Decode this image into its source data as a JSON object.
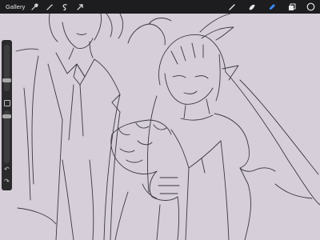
{
  "topbar": {
    "gallery_label": "Gallery",
    "left_tools": [
      "wrench-icon",
      "magic-wand-icon",
      "selection-s-icon",
      "transform-arrow-icon"
    ],
    "right_tools": [
      "brush-icon",
      "smudge-icon",
      "eraser-icon",
      "layers-icon",
      "color-swatch-icon"
    ],
    "active_tool": "eraser-icon",
    "accent_color": "#3b8cff",
    "swatch_color": "#1e1e1e"
  },
  "sidebar": {
    "brush_size_level": 0.45,
    "brush_opacity_level": 0.2,
    "tools": [
      "undo-icon",
      "redo-icon"
    ]
  },
  "canvas": {
    "background_color": "#d6cfd9",
    "line_color": "#3b3840"
  }
}
